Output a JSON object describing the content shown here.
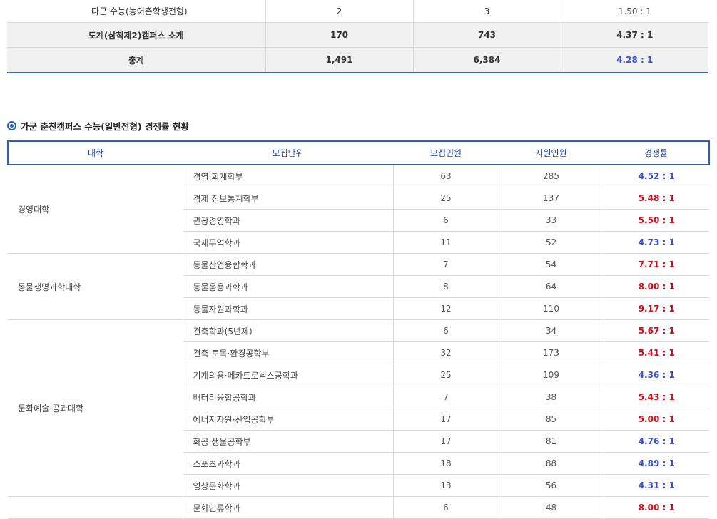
{
  "top_table": {
    "rows": [
      {
        "label": "다군 수능(농어촌학생전형)",
        "recruit": "2",
        "apply": "3",
        "ratio": "1.50 : 1",
        "kind": "plain"
      },
      {
        "label": "도계(삼척제2)캠퍼스 소계",
        "recruit": "170",
        "apply": "743",
        "ratio": "4.37 : 1",
        "kind": "sum"
      },
      {
        "label": "총계",
        "recruit": "1,491",
        "apply": "6,384",
        "ratio": "4.28 : 1",
        "kind": "total"
      }
    ]
  },
  "section": {
    "title": "가군 춘천캠퍼스 수능(일반전형) 경쟁률 현황"
  },
  "main_table": {
    "headers": {
      "college": "대학",
      "unit": "모집단위",
      "recruit": "모집인원",
      "apply": "지원인원",
      "ratio": "경쟁률"
    },
    "groups": [
      {
        "college": "경영대학",
        "rows": [
          {
            "unit": "경영·회계학부",
            "recruit": "63",
            "apply": "285",
            "ratio": "4.52 : 1",
            "color": "blue"
          },
          {
            "unit": "경제·정보통계학부",
            "recruit": "25",
            "apply": "137",
            "ratio": "5.48 : 1",
            "color": "red"
          },
          {
            "unit": "관광경영학과",
            "recruit": "6",
            "apply": "33",
            "ratio": "5.50 : 1",
            "color": "red"
          },
          {
            "unit": "국제무역학과",
            "recruit": "11",
            "apply": "52",
            "ratio": "4.73 : 1",
            "color": "blue"
          }
        ]
      },
      {
        "college": "동물생명과학대학",
        "rows": [
          {
            "unit": "동물산업융합학과",
            "recruit": "7",
            "apply": "54",
            "ratio": "7.71 : 1",
            "color": "red"
          },
          {
            "unit": "동물응용과학과",
            "recruit": "8",
            "apply": "64",
            "ratio": "8.00 : 1",
            "color": "red"
          },
          {
            "unit": "동물자원과학과",
            "recruit": "12",
            "apply": "110",
            "ratio": "9.17 : 1",
            "color": "red"
          }
        ]
      },
      {
        "college": "문화예술·공과대학",
        "rows": [
          {
            "unit": "건축학과(5년제)",
            "recruit": "6",
            "apply": "34",
            "ratio": "5.67 : 1",
            "color": "red"
          },
          {
            "unit": "건축·토목·환경공학부",
            "recruit": "32",
            "apply": "173",
            "ratio": "5.41 : 1",
            "color": "red"
          },
          {
            "unit": "기계의용·메카트로닉스공학과",
            "recruit": "25",
            "apply": "109",
            "ratio": "4.36 : 1",
            "color": "blue"
          },
          {
            "unit": "배터리융합공학과",
            "recruit": "7",
            "apply": "38",
            "ratio": "5.43 : 1",
            "color": "red"
          },
          {
            "unit": "에너지자원·산업공학부",
            "recruit": "17",
            "apply": "85",
            "ratio": "5.00 : 1",
            "color": "red"
          },
          {
            "unit": "화공·생물공학부",
            "recruit": "17",
            "apply": "81",
            "ratio": "4.76 : 1",
            "color": "blue"
          },
          {
            "unit": "스포츠과학과",
            "recruit": "18",
            "apply": "88",
            "ratio": "4.89 : 1",
            "color": "blue"
          },
          {
            "unit": "영상문화학과",
            "recruit": "13",
            "apply": "56",
            "ratio": "4.31 : 1",
            "color": "blue"
          }
        ]
      },
      {
        "college": "",
        "rows": [
          {
            "unit": "문화인류학과",
            "recruit": "6",
            "apply": "48",
            "ratio": "8.00 : 1",
            "color": "red"
          }
        ]
      }
    ]
  }
}
